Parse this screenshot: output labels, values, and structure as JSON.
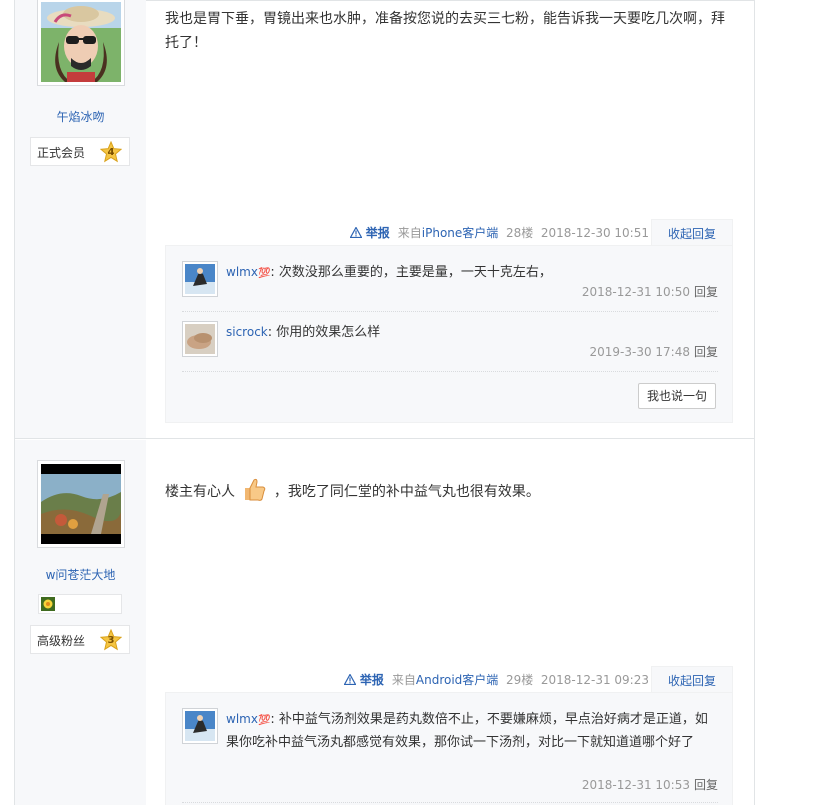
{
  "posts": [
    {
      "author": {
        "name": "午焰冰吻",
        "level_name": "正式会员",
        "level": "4"
      },
      "content": "我也是胃下垂，胃镜出来也水肿，准备按您说的去买三七粉，能告诉我一天要吃几次啊，拜托了！",
      "tail": {
        "report_label": "举报",
        "client_prefix": "来自",
        "client_name": "iPhone客户端",
        "floor": "28楼",
        "time": "2018-12-30 10:51",
        "toggle_label": "收起回复"
      },
      "replies": [
        {
          "user": "wlmx",
          "badge": "💯",
          "text": "次数没那么重要的，主要是量，一天十克左右，",
          "time": "2018-12-31 10:50",
          "reply_label": "回复"
        },
        {
          "user": "sicrock",
          "badge": "",
          "text": "你用的效果怎么样",
          "time": "2019-3-30 17:48",
          "reply_label": "回复"
        }
      ],
      "say_button": "我也说一句"
    },
    {
      "author": {
        "name": "w问苍茫大地",
        "level_name": "高级粉丝",
        "level": "3"
      },
      "content_before": "楼主有心人",
      "content_after": "，我吃了同仁堂的补中益气丸也很有效果。",
      "tail": {
        "report_label": "举报",
        "client_prefix": "来自",
        "client_name": "Android客户端",
        "floor": "29楼",
        "time": "2018-12-31 09:23",
        "toggle_label": "收起回复"
      },
      "replies": [
        {
          "user": "wlmx",
          "badge": "💯",
          "text": "补中益气汤剂效果是药丸数倍不止，不要嫌麻烦，早点治好病才是正道，如果你吃补中益气汤丸都感觉有效果，那你试一下汤剂，对比一下就知道道哪个好了",
          "time": "2018-12-31 10:53",
          "reply_label": "回复"
        }
      ]
    }
  ],
  "colors": {
    "link": "#2d64b3",
    "meta": "#999999",
    "panel": "#f7f8fa",
    "star": "#f5c542"
  },
  "icons": {
    "report": "warning-triangle-icon",
    "thumbs": "thumbs-up-icon",
    "level": "star-level-icon",
    "medal": "medal-icon"
  }
}
